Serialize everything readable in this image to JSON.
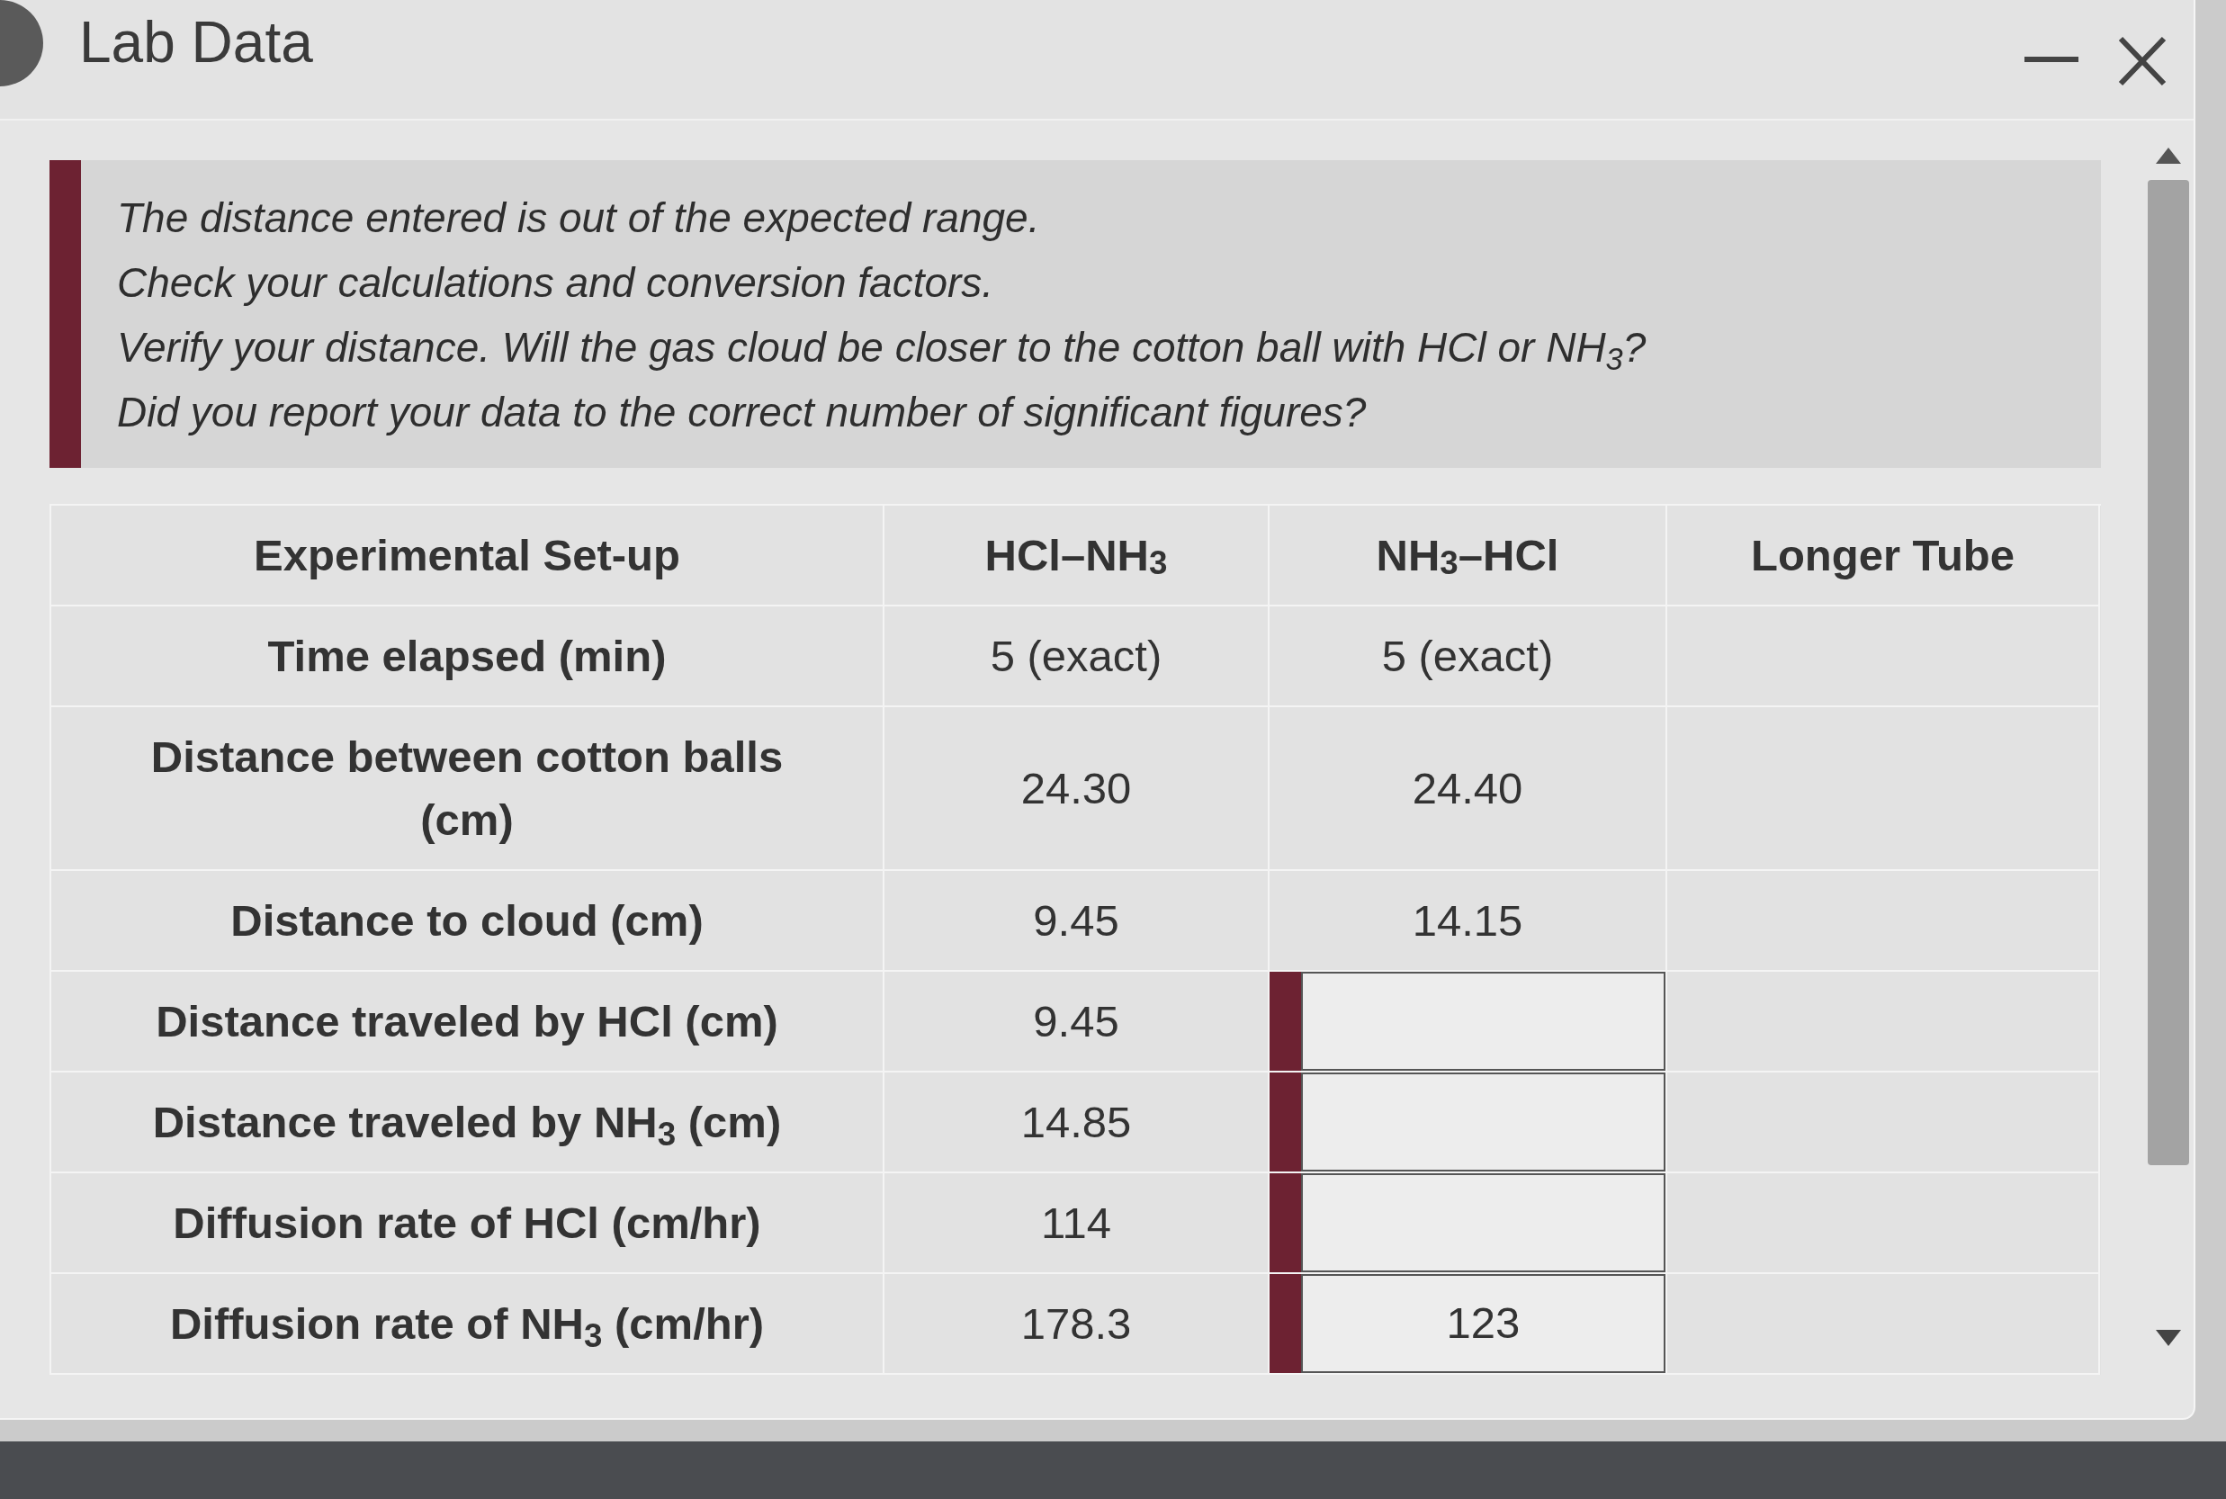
{
  "window": {
    "title": "Lab Data"
  },
  "message": {
    "lines": [
      "The distance entered is out of the expected range.",
      "Check your calculations and conversion factors.",
      "Verify your distance. Will the gas cloud be closer to the cotton ball with HCl or NH$_{3}$?",
      "Did you report your data to the correct number of significant figures?"
    ]
  },
  "table": {
    "columns": [
      "Experimental Set-up",
      "HCl–NH$_{3}$",
      "NH$_{3}$–HCl",
      "Longer Tube"
    ],
    "rows": [
      {
        "cells": [
          {
            "kind": "label",
            "text": "Time elapsed (min)"
          },
          {
            "kind": "text",
            "text": "5 (exact)"
          },
          {
            "kind": "text",
            "text": "5 (exact)"
          },
          {
            "kind": "empty"
          }
        ]
      },
      {
        "cells": [
          {
            "kind": "label",
            "text": "Distance between cotton balls (cm)"
          },
          {
            "kind": "text",
            "text": "24.30"
          },
          {
            "kind": "text",
            "text": "24.40"
          },
          {
            "kind": "empty"
          }
        ]
      },
      {
        "cells": [
          {
            "kind": "label",
            "text": "Distance to cloud (cm)"
          },
          {
            "kind": "text",
            "text": "9.45"
          },
          {
            "kind": "text",
            "text": "14.15"
          },
          {
            "kind": "empty"
          }
        ]
      },
      {
        "cells": [
          {
            "kind": "label",
            "text": "Distance traveled by HCl (cm)"
          },
          {
            "kind": "text",
            "text": "9.45"
          },
          {
            "kind": "input",
            "error": true
          },
          {
            "kind": "empty"
          }
        ]
      },
      {
        "cells": [
          {
            "kind": "label",
            "text": "Distance traveled by NH$_{3}$ (cm)"
          },
          {
            "kind": "text",
            "text": "14.85"
          },
          {
            "kind": "input",
            "error": true
          },
          {
            "kind": "empty"
          }
        ]
      },
      {
        "cells": [
          {
            "kind": "label",
            "text": "Diffusion rate of HCl (cm/hr)"
          },
          {
            "kind": "text",
            "text": "114"
          },
          {
            "kind": "input",
            "error": true
          },
          {
            "kind": "empty"
          }
        ]
      },
      {
        "cells": [
          {
            "kind": "label",
            "text": "Diffusion rate of NH$_{3}$ (cm/hr)"
          },
          {
            "kind": "text",
            "text": "178.3"
          },
          {
            "kind": "input",
            "error": true,
            "value": "123"
          },
          {
            "kind": "empty"
          }
        ]
      }
    ]
  }
}
